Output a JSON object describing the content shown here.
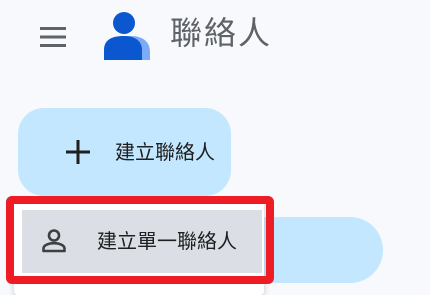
{
  "header": {
    "app_title": "聯絡人",
    "menu_icon": "hamburger-menu-icon",
    "logo_icon": "contacts-logo-icon"
  },
  "create_button": {
    "label": "建立聯絡人",
    "icon": "plus-icon"
  },
  "create_menu": {
    "items": [
      {
        "label": "建立單一聯絡人",
        "icon": "person-icon"
      }
    ]
  },
  "colors": {
    "button_bg": "#c2e7ff",
    "highlight_border": "#ee1c25",
    "menu_item_hover": "#dbdfe5",
    "logo_dark": "#0b57d0",
    "logo_light": "#7cacf8"
  }
}
